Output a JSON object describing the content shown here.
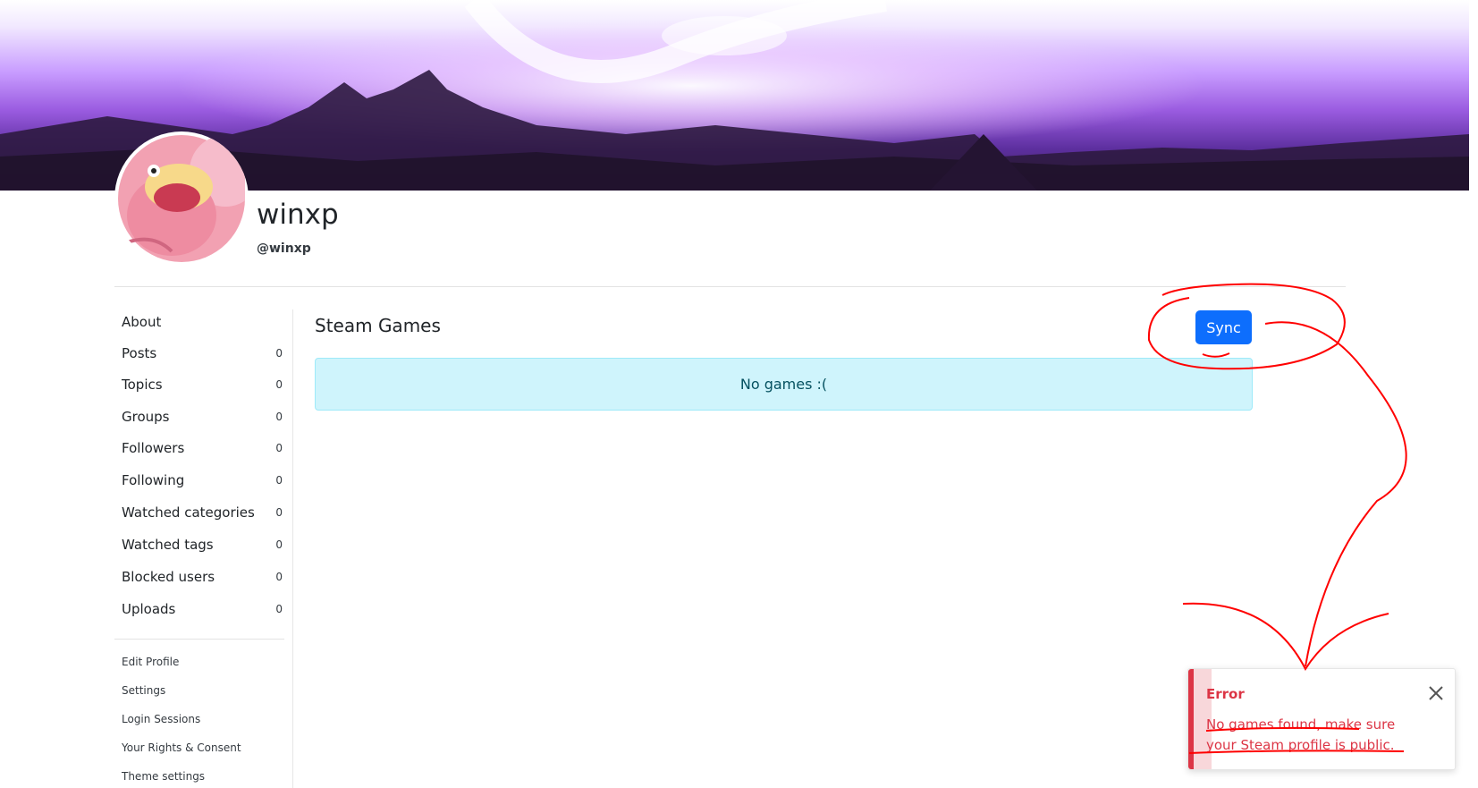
{
  "profile": {
    "username": "winxp",
    "handle": "@winxp"
  },
  "sidebar": {
    "items": [
      {
        "label": "About",
        "count": ""
      },
      {
        "label": "Posts",
        "count": "0"
      },
      {
        "label": "Topics",
        "count": "0"
      },
      {
        "label": "Groups",
        "count": "0"
      },
      {
        "label": "Followers",
        "count": "0"
      },
      {
        "label": "Following",
        "count": "0"
      },
      {
        "label": "Watched categories",
        "count": "0"
      },
      {
        "label": "Watched tags",
        "count": "0"
      },
      {
        "label": "Blocked users",
        "count": "0"
      },
      {
        "label": "Uploads",
        "count": "0"
      }
    ],
    "links": [
      {
        "label": "Edit Profile"
      },
      {
        "label": "Settings"
      },
      {
        "label": "Login Sessions"
      },
      {
        "label": "Your Rights & Consent"
      },
      {
        "label": "Theme settings"
      }
    ]
  },
  "main": {
    "title": "Steam Games",
    "sync_label": "Sync",
    "empty_message": "No games :("
  },
  "toast": {
    "title": "Error",
    "message": "No games found, make sure your Steam profile is public."
  },
  "colors": {
    "primary": "#0d6efd",
    "info_bg": "#cff4fc",
    "danger": "#dc3545",
    "annotation": "#ff0000"
  }
}
